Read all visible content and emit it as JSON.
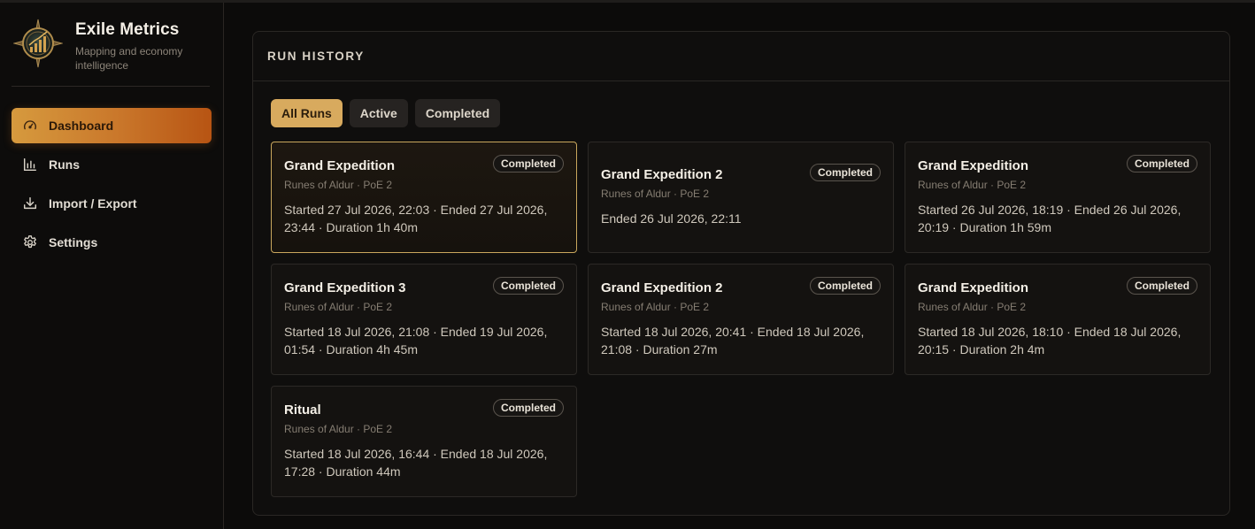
{
  "brand": {
    "title": "Exile Metrics",
    "subtitle": "Mapping and economy intelligence"
  },
  "nav": [
    {
      "label": "Dashboard",
      "icon": "gauge-icon",
      "active": true
    },
    {
      "label": "Runs",
      "icon": "bar-chart-icon",
      "active": false
    },
    {
      "label": "Import / Export",
      "icon": "download-icon",
      "active": false
    },
    {
      "label": "Settings",
      "icon": "gear-icon",
      "active": false
    }
  ],
  "panel": {
    "title": "RUN HISTORY"
  },
  "filters": [
    {
      "label": "All Runs",
      "active": true
    },
    {
      "label": "Active",
      "active": false
    },
    {
      "label": "Completed",
      "active": false
    }
  ],
  "runs": [
    {
      "title": "Grand Expedition",
      "status": "Completed",
      "subtitle": "Runes of Aldur · PoE 2",
      "meta": "Started 27 Jul 2026, 22:03 · Ended 27 Jul 2026, 23:44 · Duration 1h 40m"
    },
    {
      "title": "Grand Expedition 2",
      "status": "Completed",
      "subtitle": "Runes of Aldur · PoE 2",
      "meta": "Ended 26 Jul 2026, 22:11"
    },
    {
      "title": "Grand Expedition",
      "status": "Completed",
      "subtitle": "Runes of Aldur · PoE 2",
      "meta": "Started 26 Jul 2026, 18:19 · Ended 26 Jul 2026, 20:19 · Duration 1h 59m"
    },
    {
      "title": "Grand Expedition 3",
      "status": "Completed",
      "subtitle": "Runes of Aldur · PoE 2",
      "meta": "Started 18 Jul 2026, 21:08 · Ended 19 Jul 2026, 01:54 · Duration 4h 45m"
    },
    {
      "title": "Grand Expedition 2",
      "status": "Completed",
      "subtitle": "Runes of Aldur · PoE 2",
      "meta": "Started 18 Jul 2026, 20:41 · Ended 18 Jul 2026, 21:08 · Duration 27m"
    },
    {
      "title": "Grand Expedition",
      "status": "Completed",
      "subtitle": "Runes of Aldur · PoE 2",
      "meta": "Started 18 Jul 2026, 18:10 · Ended 18 Jul 2026, 20:15 · Duration 2h 4m"
    },
    {
      "title": "Ritual",
      "status": "Completed",
      "subtitle": "Runes of Aldur · PoE 2",
      "meta": "Started 18 Jul 2026, 16:44 · Ended 18 Jul 2026, 17:28 · Duration 44m"
    }
  ],
  "colors": {
    "accent": "#d8aa5e",
    "accent_gradient_end": "#b75413",
    "background": "#0c0b0a",
    "card_border_selected": "#c9a75d"
  }
}
